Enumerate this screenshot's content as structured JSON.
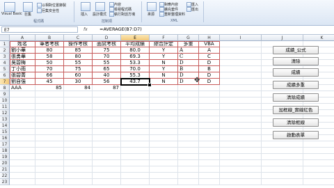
{
  "ribbon": {
    "vb_label": "Visual Basic",
    "macro_label": "巨集",
    "relref_label": "以相對位置錄製",
    "security_label": "巨集安全性",
    "group_code": "程式碼",
    "insert_label": "插入",
    "design_label": "設計模式",
    "props_label": "內容",
    "viewcode_label": "檢視程式碼",
    "rundialog_label": "執行對話方塊",
    "group_controls": "控制項",
    "source_label": "來源",
    "mapprops_label": "對應內容",
    "expansion_label": "擴充套件",
    "refresh_label": "重新整理資料",
    "import_label": "匯入",
    "export_label": "匯出",
    "group_xml": "XML"
  },
  "formula_bar": {
    "name_box": "E7",
    "fx": "fx",
    "formula": "=AVERAGE(B7:D7)"
  },
  "columns": [
    "A",
    "B",
    "C",
    "D",
    "E",
    "F",
    "G",
    "H",
    "I",
    "J",
    "K"
  ],
  "rows": [
    "1",
    "2",
    "3",
    "4",
    "5",
    "6",
    "7",
    "8",
    "9",
    "10",
    "11",
    "12",
    "13",
    "14",
    "15",
    "16",
    "17",
    "18",
    "19",
    "20",
    "21",
    "22",
    "23"
  ],
  "table": {
    "headers": [
      "姓名",
      "筆者考核",
      "操作考核",
      "面試考核",
      "平均成績",
      "綜合評定",
      "多重",
      "VBA"
    ],
    "data": [
      [
        "劉小華",
        "80",
        "85",
        "75",
        "80.0",
        "Y",
        "A",
        "A"
      ],
      [
        "張勇華",
        "58",
        "80",
        "70",
        "69.3",
        "Y",
        "C",
        "C"
      ],
      [
        "吳碧梅",
        "50",
        "55",
        "55",
        "53.3",
        "N",
        "D",
        "D"
      ],
      [
        "丁小雨",
        "70",
        "75",
        "65",
        "70.0",
        "Y",
        "B",
        "B"
      ],
      [
        "張碧菁",
        "66",
        "60",
        "40",
        "55.3",
        "N",
        "D",
        "D"
      ],
      [
        "劉自強",
        "45",
        "30",
        "56",
        "43.7",
        "N",
        "D",
        "D"
      ]
    ],
    "row8": [
      "AAA",
      "85",
      "84",
      "87"
    ]
  },
  "buttons": [
    "成績_公式",
    "清除",
    "成績",
    "成績多重",
    "清除成績",
    "加框線_實線紅色",
    "清除框線",
    "啟動表單"
  ]
}
